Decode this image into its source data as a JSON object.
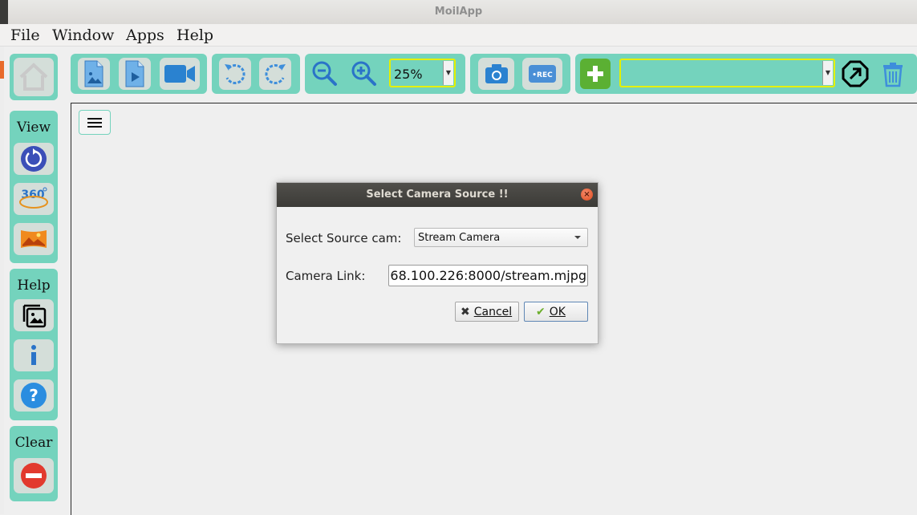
{
  "window": {
    "title": "MoilApp"
  },
  "menu": [
    "File",
    "Window",
    "Apps",
    "Help"
  ],
  "toolbar": {
    "zoom_value": "25%",
    "source_combo_value": ""
  },
  "sidebar": {
    "view_label": "View",
    "help_label": "Help",
    "clear_label": "Clear"
  },
  "dialog": {
    "title": "Select Camera Source !!",
    "source_label": "Select Source cam:",
    "source_value": "Stream Camera",
    "link_label": "Camera Link:",
    "link_value": "68.100.226:8000/stream.mjpg",
    "cancel_label": "Cancel",
    "ok_label": "OK"
  },
  "colors": {
    "accent": "#74d3bd",
    "highlight": "#e5f000",
    "dialog_titlebar": "#3c3b37"
  }
}
